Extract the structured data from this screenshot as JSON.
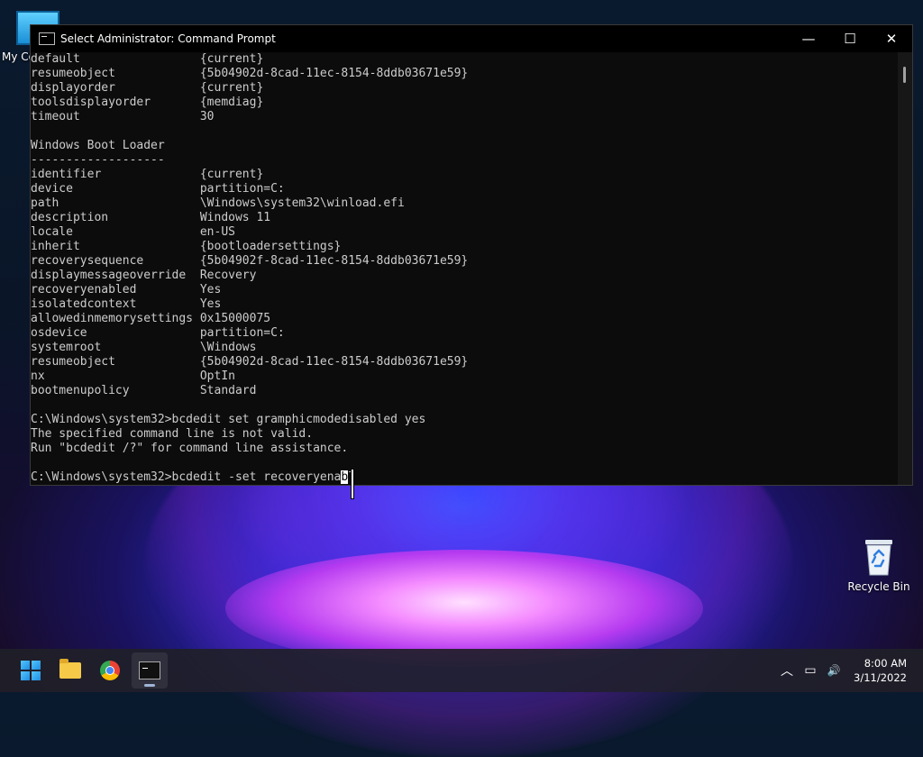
{
  "desktop": {
    "icons": [
      {
        "label": "My Co",
        "icon": "computer-icon"
      },
      {
        "label": "Recycle Bin",
        "icon": "recycle-bin-icon"
      }
    ]
  },
  "window": {
    "title": "Select Administrator: Command Prompt",
    "controls": {
      "minimize": "—",
      "maximize": "☐",
      "close": "✕"
    }
  },
  "console": {
    "lines": [
      "default                 {current}",
      "resumeobject            {5b04902d-8cad-11ec-8154-8ddb03671e59}",
      "displayorder            {current}",
      "toolsdisplayorder       {memdiag}",
      "timeout                 30",
      "",
      "Windows Boot Loader",
      "-------------------",
      "identifier              {current}",
      "device                  partition=C:",
      "path                    \\Windows\\system32\\winload.efi",
      "description             Windows 11",
      "locale                  en-US",
      "inherit                 {bootloadersettings}",
      "recoverysequence        {5b04902f-8cad-11ec-8154-8ddb03671e59}",
      "displaymessageoverride  Recovery",
      "recoveryenabled         Yes",
      "isolatedcontext         Yes",
      "allowedinmemorysettings 0x15000075",
      "osdevice                partition=C:",
      "systemroot              \\Windows",
      "resumeobject            {5b04902d-8cad-11ec-8154-8ddb03671e59}",
      "nx                      OptIn",
      "bootmenupolicy          Standard",
      "",
      "C:\\Windows\\system32>bcdedit set gramphicmodedisabled yes",
      "The specified command line is not valid.",
      "Run \"bcdedit /?\" for command line assistance.",
      ""
    ],
    "prompt_line": {
      "before": "C:\\Windows\\system32>bcdedit -set recoveryena",
      "selected": "b",
      "after": "l"
    }
  },
  "taskbar": {
    "apps": [
      {
        "name": "Start",
        "icon": "windows-logo-icon"
      },
      {
        "name": "File Explorer",
        "icon": "folder-icon"
      },
      {
        "name": "Google Chrome",
        "icon": "chrome-icon"
      },
      {
        "name": "Command Prompt",
        "icon": "terminal-icon",
        "active": true
      }
    ],
    "tray": {
      "chevron": "︿",
      "network": "▭",
      "volume": "🔊",
      "time": "8:00 AM",
      "date": "3/11/2022"
    }
  }
}
